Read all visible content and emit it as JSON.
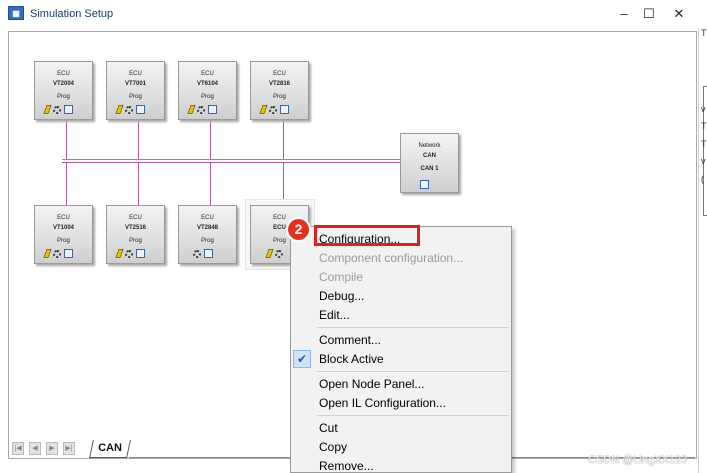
{
  "window": {
    "title": "Simulation Setup",
    "icon": "app-icon",
    "controls": {
      "minimize": "–",
      "maximize": "☐",
      "close": "✕"
    }
  },
  "top_nodes": [
    {
      "type": "ECU",
      "name": "VT2004",
      "sub": "Prog"
    },
    {
      "type": "ECU",
      "name": "VT7001",
      "sub": "Prog"
    },
    {
      "type": "ECU",
      "name": "VT6104",
      "sub": "Prog"
    },
    {
      "type": "ECU",
      "name": "VT2816",
      "sub": "Prog"
    }
  ],
  "bottom_nodes": [
    {
      "type": "ECU",
      "name": "VT1004",
      "sub": "Prog"
    },
    {
      "type": "ECU",
      "name": "VT2516",
      "sub": "Prog"
    },
    {
      "type": "ECU",
      "name": "VT2848",
      "sub": "Prog"
    },
    {
      "type": "ECU",
      "name": "ECU",
      "sub": "Prog"
    }
  ],
  "network_node": {
    "type": "Network",
    "name": "CAN",
    "sub": "CAN 1"
  },
  "node_icons": [
    "pencil-icon",
    "gear-icon",
    "panel-icon"
  ],
  "bus": {
    "colors": [
      "#8a8aa8",
      "#b05a9a"
    ]
  },
  "tabs": {
    "active": "CAN",
    "nav_buttons": [
      "|◀",
      "◀",
      "▶",
      "▶|"
    ]
  },
  "context_menu": {
    "items": [
      {
        "label": "Configuration...",
        "disabled": false
      },
      {
        "label": "Component configuration...",
        "disabled": true
      },
      {
        "label": "Compile",
        "disabled": true
      },
      {
        "label": "Debug...",
        "disabled": false
      },
      {
        "label": "Edit...",
        "disabled": false
      },
      {
        "label": "Comment...",
        "disabled": false
      },
      {
        "label": "Block Active",
        "disabled": false,
        "checked": true
      },
      {
        "label": "Open Node Panel...",
        "disabled": false
      },
      {
        "label": "Open IL Configuration...",
        "disabled": false
      },
      {
        "label": "Cut",
        "disabled": false
      },
      {
        "label": "Copy",
        "disabled": false
      },
      {
        "label": "Remove...",
        "disabled": false
      }
    ]
  },
  "annotation": {
    "badge": "2",
    "color": "#e02020"
  },
  "right_edge_text": [
    "T",
    "v",
    "T",
    "T",
    "v",
    "("
  ],
  "watermark": "CSDN @LingXX123"
}
